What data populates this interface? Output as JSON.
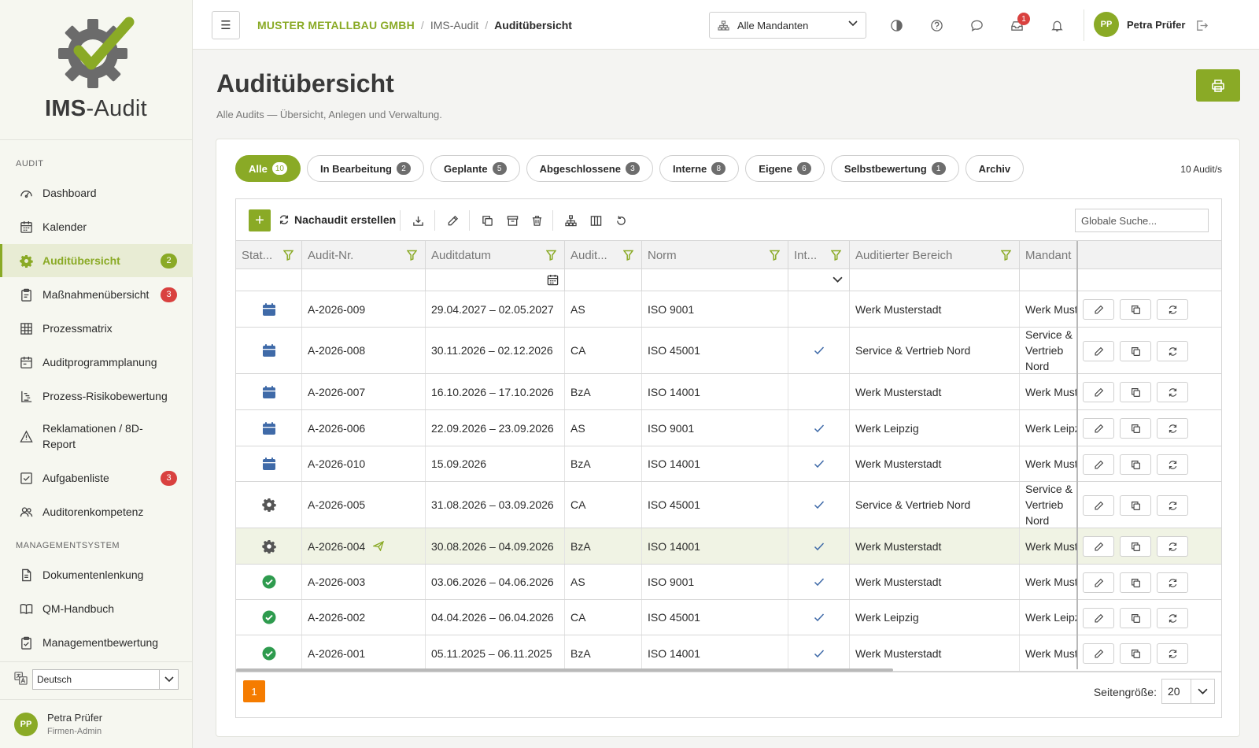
{
  "app": {
    "name_bold": "IMS",
    "name_rest": "-Audit"
  },
  "sidebar": {
    "sections": [
      "AUDIT",
      "MANAGEMENTSYSTEM"
    ],
    "items": [
      {
        "label": "Dashboard",
        "icon": "gauge-icon"
      },
      {
        "label": "Kalender",
        "icon": "calendar-icon"
      },
      {
        "label": "Auditübersicht",
        "icon": "gear-icon",
        "badge": "2",
        "active": true
      },
      {
        "label": "Maßnahmenübersicht",
        "icon": "clipboard-icon",
        "badge": "3"
      },
      {
        "label": "Prozessmatrix",
        "icon": "grid-icon"
      },
      {
        "label": "Auditprogrammplanung",
        "icon": "calendar-plan-icon"
      },
      {
        "label": "Prozess-Risikobewertung",
        "icon": "list-tree-icon"
      },
      {
        "label": "Reklamationen / 8D-Report",
        "icon": "warning-icon"
      },
      {
        "label": "Aufgabenliste",
        "icon": "checkbox-icon",
        "badge": "3"
      },
      {
        "label": "Auditorenkompetenz",
        "icon": "users-icon"
      },
      {
        "label": "Dokumentenlenkung",
        "icon": "document-icon"
      },
      {
        "label": "QM-Handbuch",
        "icon": "book-icon"
      },
      {
        "label": "Managementbewertung",
        "icon": "clipboard-check-icon"
      }
    ],
    "language": "Deutsch",
    "user": {
      "initials": "PP",
      "name": "Petra Prüfer",
      "role": "Firmen-Admin"
    }
  },
  "topbar": {
    "breadcrumbs": [
      "MUSTER METALLBAU GMBH",
      "IMS-Audit",
      "Auditübersicht"
    ],
    "mandant": "Alle Mandanten",
    "notification_count": "1",
    "user": {
      "initials": "PP",
      "name": "Petra Prüfer"
    }
  },
  "page": {
    "title": "Auditübersicht",
    "subtitle": "Alle Audits — Übersicht, Anlegen und Verwaltung."
  },
  "tabs": [
    {
      "label": "Alle",
      "count": "10",
      "active": true
    },
    {
      "label": "In Bearbeitung",
      "count": "2"
    },
    {
      "label": "Geplante",
      "count": "5"
    },
    {
      "label": "Abgeschlossene",
      "count": "3"
    },
    {
      "label": "Interne",
      "count": "8"
    },
    {
      "label": "Eigene",
      "count": "6"
    },
    {
      "label": "Selbstbewertung",
      "count": "1"
    },
    {
      "label": "Archiv",
      "count": ""
    }
  ],
  "audit_count": "10 Audit/s",
  "toolbar": {
    "nachaudit_label": "Nachaudit erstellen",
    "search_placeholder": "Globale Suche..."
  },
  "table": {
    "columns": [
      "Stat...",
      "Audit-Nr.",
      "Auditdatum",
      "Audit...",
      "Norm",
      "Int...",
      "Auditierter Bereich",
      "Mandant"
    ],
    "rows": [
      {
        "status": "geplant",
        "nr": "A-2026-009",
        "datum": "29.04.2027 – 02.05.2027",
        "art": "AS",
        "norm": "ISO 9001",
        "intern": false,
        "bereich": "Werk Musterstadt",
        "mandant": "Werk Musterstadt"
      },
      {
        "status": "geplant",
        "nr": "A-2026-008",
        "datum": "30.11.2026 – 02.12.2026",
        "art": "CA",
        "norm": "ISO 45001",
        "intern": true,
        "bereich": "Service & Vertrieb Nord",
        "mandant": "Service & Vertrieb Nord"
      },
      {
        "status": "geplant",
        "nr": "A-2026-007",
        "datum": "16.10.2026 – 17.10.2026",
        "art": "BzA",
        "norm": "ISO 14001",
        "intern": false,
        "bereich": "Werk Musterstadt",
        "mandant": "Werk Musterstadt"
      },
      {
        "status": "geplant",
        "nr": "A-2026-006",
        "datum": "22.09.2026 – 23.09.2026",
        "art": "AS",
        "norm": "ISO 9001",
        "intern": true,
        "bereich": "Werk Leipzig",
        "mandant": "Werk Leipzig"
      },
      {
        "status": "geplant",
        "nr": "A-2026-010",
        "datum": "15.09.2026",
        "art": "BzA",
        "norm": "ISO 14001",
        "intern": true,
        "bereich": "Werk Musterstadt",
        "mandant": "Werk Musterstadt"
      },
      {
        "status": "bearbeitung",
        "nr": "A-2026-005",
        "datum": "31.08.2026 – 03.09.2026",
        "art": "CA",
        "norm": "ISO 45001",
        "intern": true,
        "bereich": "Service & Vertrieb Nord",
        "mandant": "Service & Vertrieb Nord"
      },
      {
        "status": "bearbeitung",
        "nr": "A-2026-004",
        "datum": "30.08.2026 – 04.09.2026",
        "art": "BzA",
        "norm": "ISO 14001",
        "intern": true,
        "bereich": "Werk Musterstadt",
        "mandant": "Werk Musterstadt",
        "selected": true,
        "sent": true
      },
      {
        "status": "abgeschlossen",
        "nr": "A-2026-003",
        "datum": "03.06.2026 – 04.06.2026",
        "art": "AS",
        "norm": "ISO 9001",
        "intern": true,
        "bereich": "Werk Musterstadt",
        "mandant": "Werk Musterstadt"
      },
      {
        "status": "abgeschlossen",
        "nr": "A-2026-002",
        "datum": "04.04.2026 – 06.04.2026",
        "art": "CA",
        "norm": "ISO 45001",
        "intern": true,
        "bereich": "Werk Leipzig",
        "mandant": "Werk Leipzig"
      },
      {
        "status": "abgeschlossen",
        "nr": "A-2026-001",
        "datum": "05.11.2025 – 06.11.2025",
        "art": "BzA",
        "norm": "ISO 14001",
        "intern": true,
        "bereich": "Werk Musterstadt",
        "mandant": "Werk Musterstadt"
      }
    ]
  },
  "pager": {
    "page": "1",
    "size_label": "Seitengröße:",
    "size": "20"
  },
  "colors": {
    "accent": "#8aaa26",
    "badge": "#d9413f",
    "planned": "#3f6aa8",
    "done": "#2e9b4e",
    "page_active": "#f57c00"
  }
}
